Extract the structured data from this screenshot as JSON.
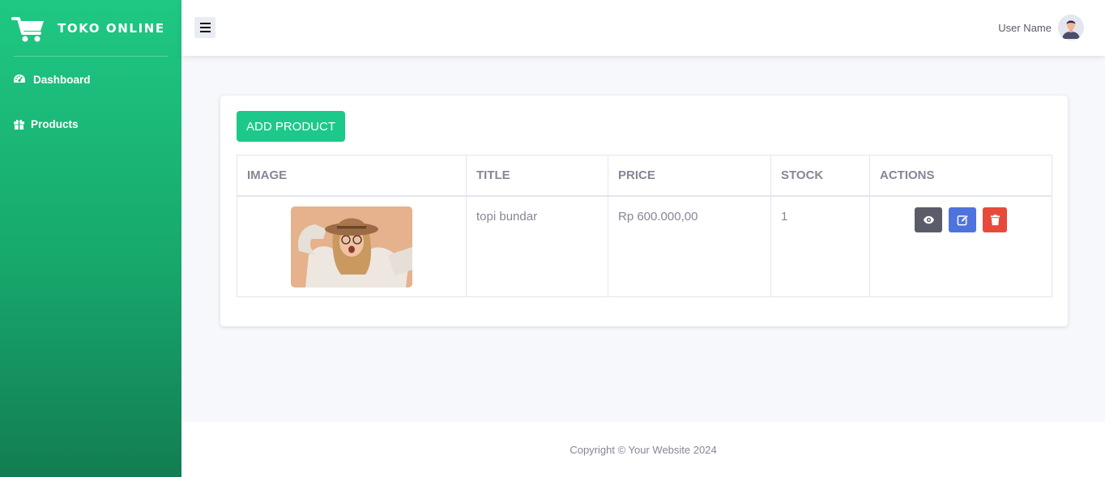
{
  "brand": {
    "name": "TOKO ONLINE",
    "icon": "shopping-cart-icon"
  },
  "sidebar": {
    "items": [
      {
        "label": "Dashboard",
        "icon": "tachometer-icon"
      },
      {
        "label": "Products",
        "icon": "gift-icon"
      }
    ]
  },
  "topbar": {
    "menu_icon": "hamburger-icon",
    "user_name": "User Name"
  },
  "main": {
    "add_button": "ADD PRODUCT",
    "table": {
      "headers": [
        "IMAGE",
        "TITLE",
        "PRICE",
        "STOCK",
        "ACTIONS"
      ],
      "rows": [
        {
          "image": "product-photo",
          "title": "topi bundar",
          "price": "Rp 600.000,00",
          "stock": "1"
        }
      ],
      "action_icons": [
        "eye-icon",
        "edit-icon",
        "trash-icon"
      ]
    }
  },
  "footer": {
    "text": "Copyright © Your Website 2024"
  },
  "colors": {
    "sidebar_top": "#1fc884",
    "sidebar_bottom": "#137d52",
    "add_button": "#1cc88a",
    "view_button": "#5a5c69",
    "edit_button": "#4e73df",
    "delete_button": "#e74a3b"
  }
}
